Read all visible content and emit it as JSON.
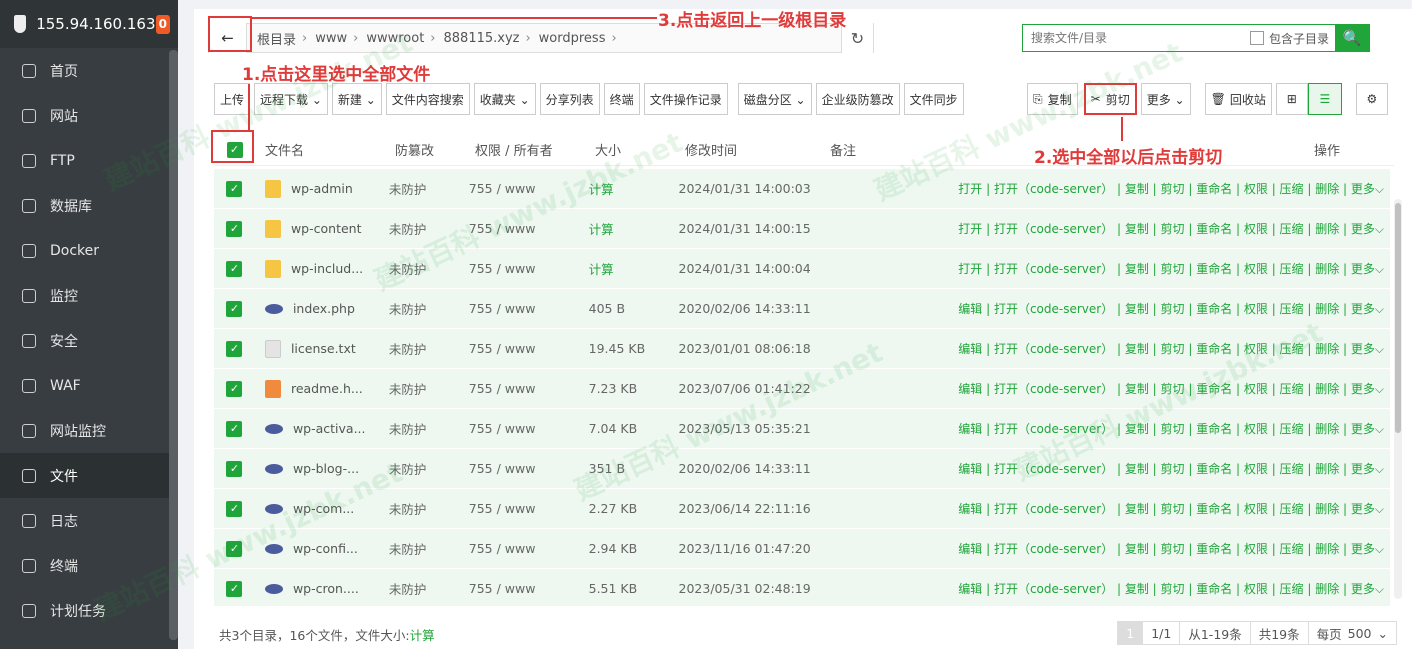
{
  "sidebar": {
    "ip": "155.94.160.163",
    "badge": "0",
    "items": [
      {
        "label": "首页",
        "icon": "home-icon"
      },
      {
        "label": "网站",
        "icon": "globe-icon"
      },
      {
        "label": "FTP",
        "icon": "ftp-icon"
      },
      {
        "label": "数据库",
        "icon": "database-icon"
      },
      {
        "label": "Docker",
        "icon": "docker-icon"
      },
      {
        "label": "监控",
        "icon": "monitor-icon"
      },
      {
        "label": "安全",
        "icon": "shield-icon"
      },
      {
        "label": "WAF",
        "icon": "waf-icon"
      },
      {
        "label": "网站监控",
        "icon": "chart-icon"
      },
      {
        "label": "文件",
        "icon": "folder-icon",
        "active": true
      },
      {
        "label": "日志",
        "icon": "log-icon"
      },
      {
        "label": "终端",
        "icon": "terminal-icon"
      },
      {
        "label": "计划任务",
        "icon": "clock-icon"
      }
    ]
  },
  "path": {
    "crumbs": [
      "根目录",
      "www",
      "wwwroot",
      "888115.xyz",
      "wordpress"
    ],
    "back_label": "←",
    "refresh_label": "↻"
  },
  "search": {
    "placeholder": "搜索文件/目录",
    "subdir_label": "包含子目录",
    "button_label": "🔍"
  },
  "toolbar": {
    "left": [
      "上传",
      "远程下载 ⌄",
      "新建 ⌄",
      "文件内容搜索",
      "收藏夹 ⌄",
      "分享列表",
      "终端",
      "文件操作记录",
      "磁盘分区 ⌄",
      "企业级防篡改",
      "文件同步"
    ],
    "copy": "复制",
    "cut": "剪切",
    "more": "更多 ⌄",
    "recycle": "回收站"
  },
  "table": {
    "headers": {
      "name": "文件名",
      "protect": "防篡改",
      "perm": "权限 / 所有者",
      "size": "大小",
      "time": "修改时间",
      "note": "备注",
      "ops": "操作"
    },
    "rows": [
      {
        "name": "wp-admin",
        "type": "folder",
        "protect": "未防护",
        "perm": "755 / www",
        "size": "计算",
        "time": "2024/01/31 14:00:03",
        "open": "打开"
      },
      {
        "name": "wp-content",
        "type": "folder",
        "protect": "未防护",
        "perm": "755 / www",
        "size": "计算",
        "time": "2024/01/31 14:00:15",
        "open": "打开"
      },
      {
        "name": "wp-includ...",
        "type": "folder",
        "protect": "未防护",
        "perm": "755 / www",
        "size": "计算",
        "time": "2024/01/31 14:00:04",
        "open": "打开"
      },
      {
        "name": "index.php",
        "type": "php",
        "protect": "未防护",
        "perm": "755 / www",
        "size": "405 B",
        "time": "2020/02/06 14:33:11",
        "open": "编辑"
      },
      {
        "name": "license.txt",
        "type": "txt",
        "protect": "未防护",
        "perm": "755 / www",
        "size": "19.45 KB",
        "time": "2023/01/01 08:06:18",
        "open": "编辑"
      },
      {
        "name": "readme.h...",
        "type": "html",
        "protect": "未防护",
        "perm": "755 / www",
        "size": "7.23 KB",
        "time": "2023/07/06 01:41:22",
        "open": "编辑"
      },
      {
        "name": "wp-activa...",
        "type": "php",
        "protect": "未防护",
        "perm": "755 / www",
        "size": "7.04 KB",
        "time": "2023/05/13 05:35:21",
        "open": "编辑"
      },
      {
        "name": "wp-blog-...",
        "type": "php",
        "protect": "未防护",
        "perm": "755 / www",
        "size": "351 B",
        "time": "2020/02/06 14:33:11",
        "open": "编辑"
      },
      {
        "name": "wp-com...",
        "type": "php",
        "protect": "未防护",
        "perm": "755 / www",
        "size": "2.27 KB",
        "time": "2023/06/14 22:11:16",
        "open": "编辑"
      },
      {
        "name": "wp-confi...",
        "type": "php",
        "protect": "未防护",
        "perm": "755 / www",
        "size": "2.94 KB",
        "time": "2023/11/16 01:47:20",
        "open": "编辑"
      },
      {
        "name": "wp-cron....",
        "type": "php",
        "protect": "未防护",
        "perm": "755 / www",
        "size": "5.51 KB",
        "time": "2023/05/31 02:48:19",
        "open": "编辑"
      }
    ],
    "ops_rest": " | 打开（code-server） | 复制 | 剪切 | 重命名 | 权限 | 压缩 | 删除 | 更多⌵"
  },
  "footer": {
    "summary": "共3个目录，16个文件，文件大小: ",
    "calc": "计算",
    "page_current": "1",
    "page_total": "1/1",
    "range": "从1-19条",
    "total": "共19条",
    "per_page_label": "每页",
    "per_page_value": "500"
  },
  "annotations": {
    "step1": "1.点击这里选中全部文件",
    "step2": "2.选中全部以后点击剪切",
    "step3": "3.点击返回上一级根目录"
  },
  "watermark": "建站百科 www.jzbk.net",
  "colors": {
    "accent": "#20a53a",
    "annotation": "#e03b3b",
    "sidebar": "#383d41"
  }
}
